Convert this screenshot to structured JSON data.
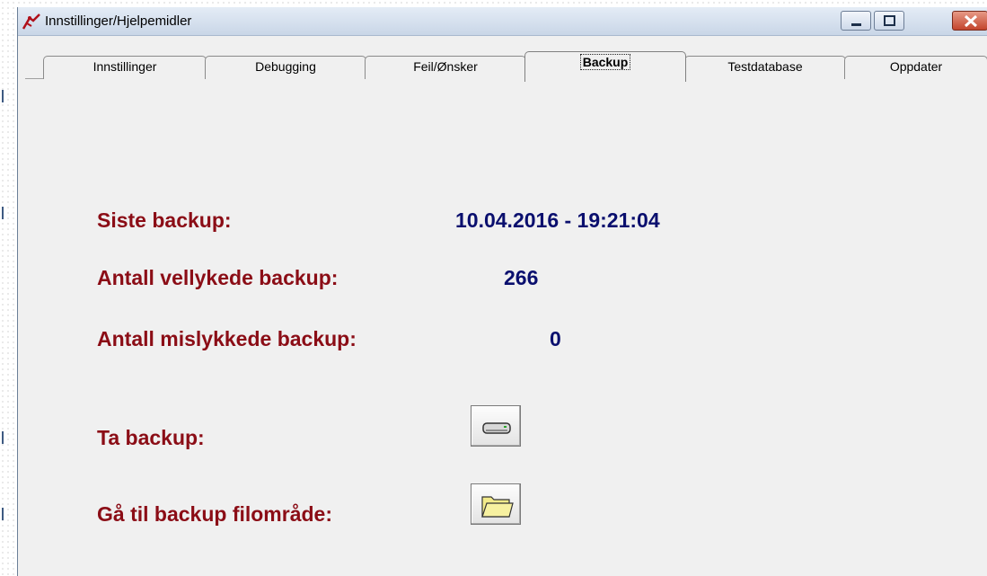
{
  "window": {
    "title": "Innstillinger/Hjelpemidler"
  },
  "tabs": [
    {
      "label": "Innstillinger"
    },
    {
      "label": "Debugging"
    },
    {
      "label": "Feil/Ønsker"
    },
    {
      "label": "Backup",
      "selected": true
    },
    {
      "label": "Testdatabase"
    },
    {
      "label": "Oppdater"
    }
  ],
  "backup": {
    "last_label": "Siste backup:",
    "last_value": "10.04.2016 - 19:21:04",
    "success_label": "Antall vellykede backup:",
    "success_value": "266",
    "failed_label": "Antall mislykkede backup:",
    "failed_value": "0",
    "take_label": "Ta backup:",
    "goto_label": "Gå til backup filområde:"
  },
  "colors": {
    "label": "#8b0d16",
    "value": "#0a0f6e",
    "panel": "#f0f0f0"
  },
  "icons": {
    "app": "app-logo-icon",
    "take_backup": "drive-icon",
    "goto_folder": "folder-icon"
  }
}
